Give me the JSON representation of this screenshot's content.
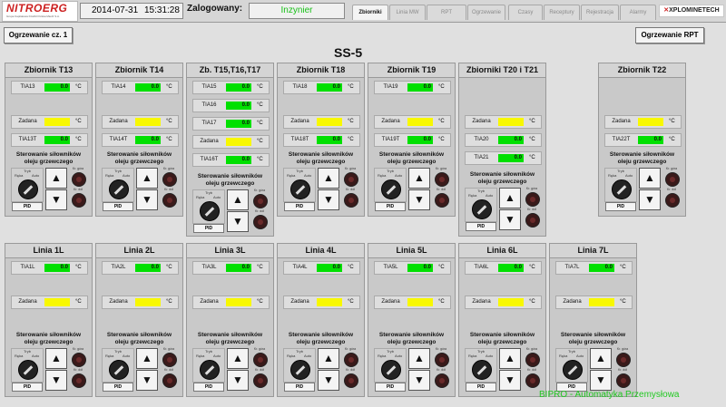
{
  "header": {
    "logo_brand": "NITROERG",
    "logo_sub": "Grupa Kapitałowa KGHM Polska Miedź S.A.",
    "date": "2014-07-31",
    "time": "15:31:28",
    "login_label": "Zalogowany:",
    "user": "Inzynier",
    "tabs": [
      "Zbiorniki",
      "Linia MW",
      "RPT",
      "Ogrzewanie",
      "Czasy",
      "Receptury",
      "Rejestracja",
      "Alarmy"
    ],
    "active_tab": "Zbiorniki",
    "partner_logo": "XPLOMINETECH"
  },
  "buttons": {
    "left": "Ogrzewanie cz. 1",
    "right": "Ogrzewanie RPT"
  },
  "title": "SS-5",
  "common": {
    "unit": "°C",
    "zadana": "Zadana",
    "ster_line1": "Sterowanie siłowników",
    "ster_line2": "oleju grzewczego",
    "tryb": "Tryb",
    "reka": "Ręka",
    "auto": "Auto",
    "pid": "PID",
    "ind_top": "Kr. góra",
    "ind_bot": "Kr. dół",
    "up_arrow": "▲",
    "down_arrow": "▼"
  },
  "panels": [
    {
      "name": "Zbiornik T13",
      "t1": "TIA13",
      "v1": "0.0",
      "zadana_value": "",
      "t2": "TIA13T",
      "v2": "0.0"
    },
    {
      "name": "Zbiornik T14",
      "t1": "TIA14",
      "v1": "0.0",
      "zadana_value": "",
      "t2": "TIA14T",
      "v2": "0.0"
    },
    {
      "name": "Zb. T15,T16,T17",
      "t1": "TIA15",
      "v1": "0.0",
      "t1b": "TIA16",
      "v1b": "0.0",
      "t1c": "TIA17",
      "v1c": "0.0",
      "zadana_value": "",
      "t2": "TIA16T",
      "v2": "0.0"
    },
    {
      "name": "Zbiornik T18",
      "t1": "TIA18",
      "v1": "0.0",
      "zadana_value": "",
      "t2": "TIA18T",
      "v2": "0.0"
    },
    {
      "name": "Zbiornik T19",
      "t1": "TIA19",
      "v1": "0.0",
      "zadana_value": "",
      "t2": "TIA19T",
      "v2": "0.0"
    },
    {
      "name": "Zbiorniki T20 i T21",
      "zadana_value": "",
      "t2": "TIA20",
      "v2": "0.0",
      "t3": "TIA21",
      "v3": "0.0"
    },
    {
      "name": "Zbiornik T22",
      "zadana_value": "",
      "t2": "TIA22T",
      "v2": "0.0"
    },
    {
      "name": "Linia 1L",
      "t1": "TIA1L",
      "v1": "0.0",
      "zadana_value": ""
    },
    {
      "name": "Linia 2L",
      "t1": "TIA2L",
      "v1": "0.0",
      "zadana_value": ""
    },
    {
      "name": "Linia 3L",
      "t1": "TIA3L",
      "v1": "0.0",
      "zadana_value": ""
    },
    {
      "name": "Linia 4L",
      "t1": "TIA4L",
      "v1": "0.0",
      "zadana_value": ""
    },
    {
      "name": "Linia 5L",
      "t1": "TIA5L",
      "v1": "0.0",
      "zadana_value": ""
    },
    {
      "name": "Linia 6L",
      "t1": "TIA6L",
      "v1": "0.0",
      "zadana_value": ""
    },
    {
      "name": "Linia 7L",
      "t1": "TIA7L",
      "v1": "0.0",
      "zadana_value": ""
    }
  ],
  "watermark": "BIPRO - Automatyka Przemysłowa"
}
